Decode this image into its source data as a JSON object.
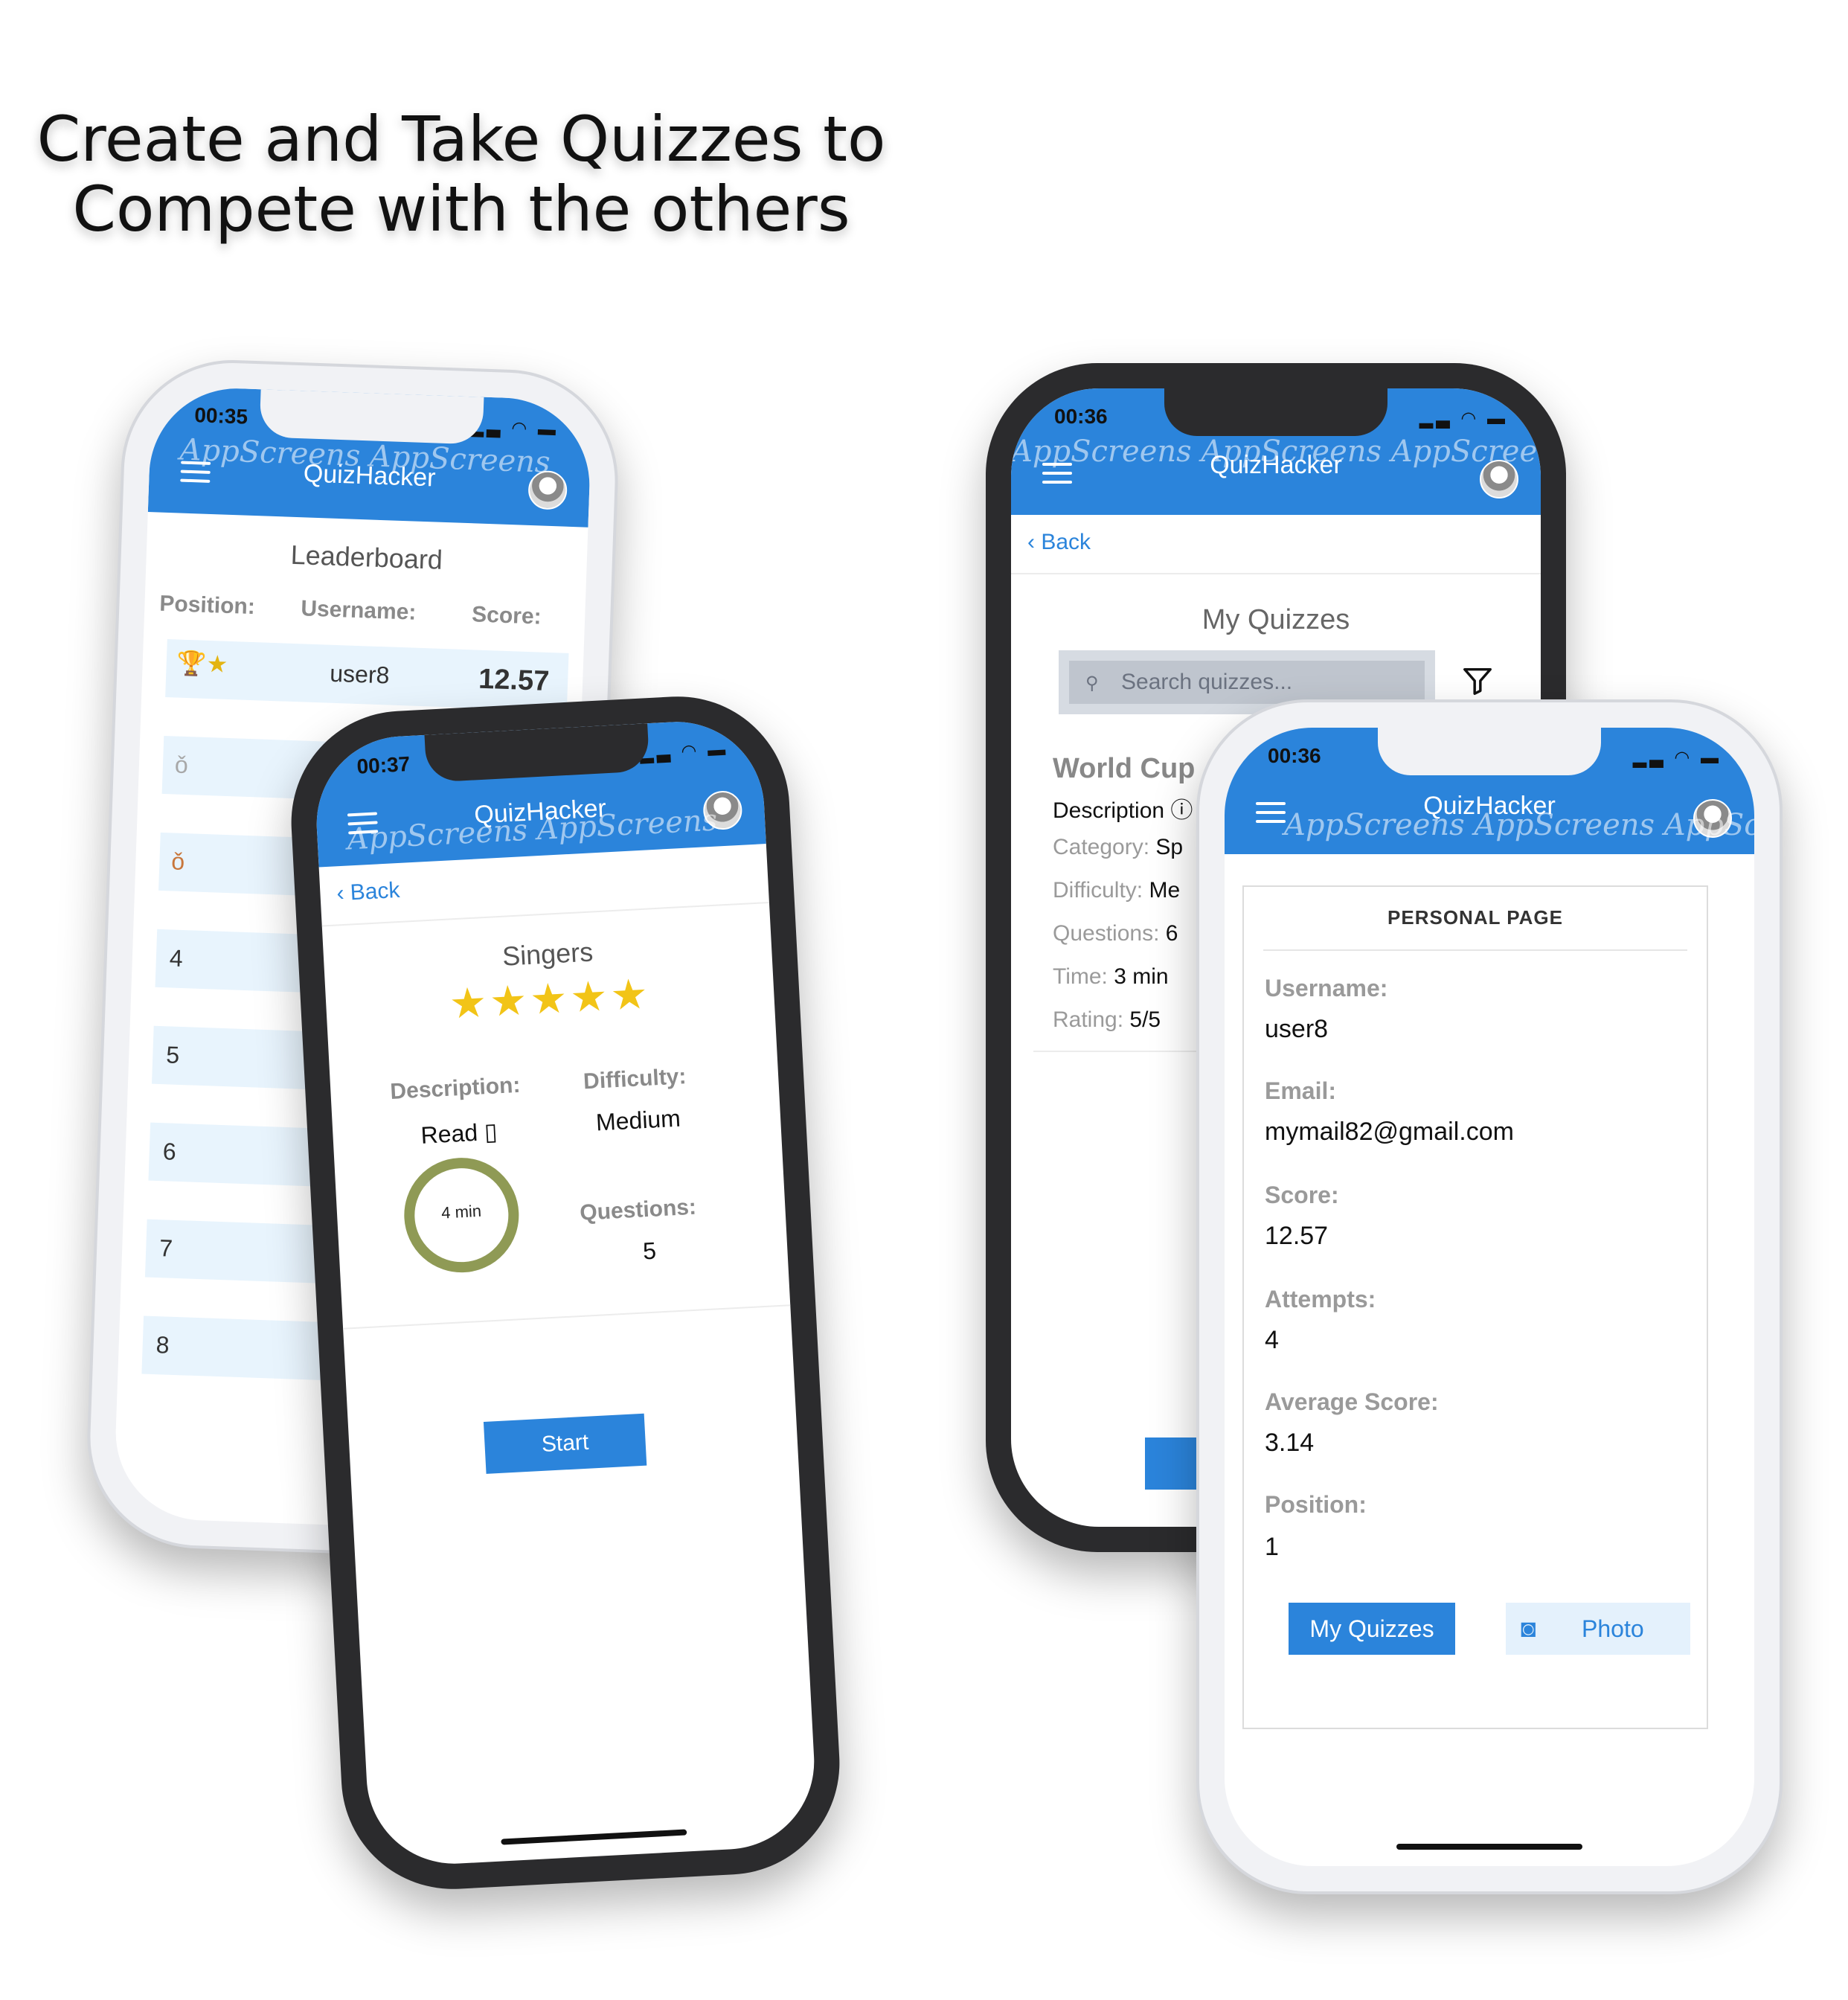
{
  "headline": [
    "Create and Take Quizzes to",
    "Compete with the others"
  ],
  "watermark": "AppScreens",
  "app": {
    "title": "QuizHacker",
    "back_label": "Back"
  },
  "colors": {
    "brand_blue": "#2b84db",
    "star_gold": "#f2c417",
    "ring_olive": "#8f9a55",
    "row_tint": "#e8f4fd"
  },
  "leaderboard": {
    "time": "00:35",
    "title": "Leaderboard",
    "headers": {
      "position": "Position:",
      "username": "Username:",
      "score": "Score:"
    },
    "rows": [
      {
        "position_icon": "trophy-icon",
        "username": "user8",
        "score": "12.57"
      },
      {
        "position_icon": "silver-medal-icon",
        "username": "",
        "score": ""
      },
      {
        "position_icon": "bronze-medal-icon",
        "username": "",
        "score": ""
      },
      {
        "position": "4"
      },
      {
        "position": "5"
      },
      {
        "position": "6"
      },
      {
        "position": "7"
      },
      {
        "position": "8"
      }
    ]
  },
  "quiz_detail": {
    "time": "00:37",
    "name": "Singers",
    "rating_stars": 5,
    "description_label": "Description:",
    "description_value": "Read",
    "difficulty_label": "Difficulty:",
    "difficulty_value": "Medium",
    "time_value": "4 min",
    "questions_label": "Questions:",
    "questions_value": "5",
    "start_label": "Start"
  },
  "my_quizzes": {
    "time": "00:36",
    "title": "My Quizzes",
    "search_placeholder": "Search quizzes...",
    "card": {
      "title": "World Cup",
      "description_label": "Description",
      "category_label": "Category:",
      "category_value": "Sp",
      "difficulty_label": "Difficulty:",
      "difficulty_value": "Me",
      "questions_label": "Questions:",
      "questions_value": "6",
      "time_label": "Time:",
      "time_value": "3 min",
      "rating_label": "Rating:",
      "rating_value": "5/5"
    }
  },
  "personal_page": {
    "time": "00:36",
    "title": "PERSONAL PAGE",
    "fields": [
      {
        "label": "Username:",
        "value": "user8"
      },
      {
        "label": "Email:",
        "value": "mymail82@gmail.com"
      },
      {
        "label": "Score:",
        "value": "12.57"
      },
      {
        "label": "Attempts:",
        "value": "4"
      },
      {
        "label": "Average Score:",
        "value": "3.14"
      },
      {
        "label": "Position:",
        "value": "1"
      }
    ],
    "my_quizzes_button": "My Quizzes",
    "photo_button": "Photo"
  }
}
